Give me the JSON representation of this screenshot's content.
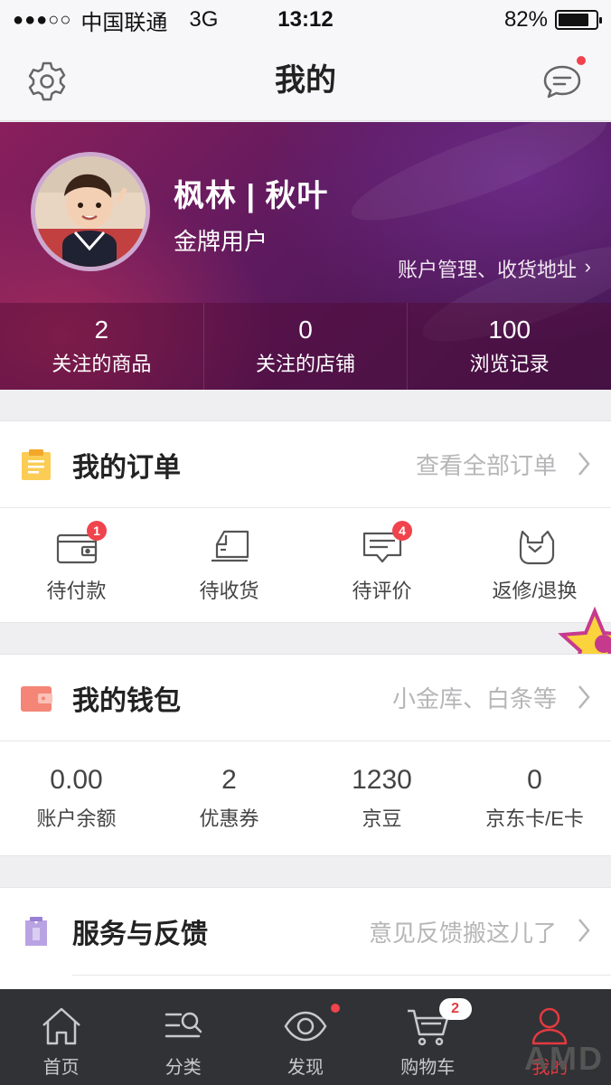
{
  "status_bar": {
    "signal": "●●●○○",
    "carrier": "中国联通",
    "network": "3G",
    "time": "13:12",
    "battery_text": "82%",
    "battery_level": 0.82
  },
  "nav": {
    "title": "我的",
    "settings_icon": "gear-icon",
    "message_icon": "message-icon"
  },
  "profile": {
    "name": "枫林 | 秋叶",
    "level": "金牌用户",
    "account_link": "账户管理、收货地址",
    "chevron": "›",
    "stats": [
      {
        "value": "2",
        "label": "关注的商品"
      },
      {
        "value": "0",
        "label": "关注的店铺"
      },
      {
        "value": "100",
        "label": "浏览记录"
      }
    ]
  },
  "orders": {
    "title": "我的订单",
    "link": "查看全部订单",
    "items": [
      {
        "label": "待付款",
        "badge": "1",
        "icon": "wallet-icon"
      },
      {
        "label": "待收货",
        "badge": "",
        "icon": "truck-icon"
      },
      {
        "label": "待评价",
        "badge": "4",
        "icon": "comment-icon"
      },
      {
        "label": "返修/退换",
        "badge": "",
        "icon": "return-icon"
      }
    ]
  },
  "wallet": {
    "title": "我的钱包",
    "link": "小金库、白条等",
    "items": [
      {
        "value": "0.00",
        "label": "账户余额"
      },
      {
        "value": "2",
        "label": "优惠券"
      },
      {
        "value": "1230",
        "label": "京豆"
      },
      {
        "value": "0",
        "label": "京东卡/E卡"
      }
    ]
  },
  "service": {
    "title": "服务与反馈",
    "link": "意见反馈搬这儿了"
  },
  "tabs": [
    {
      "label": "首页",
      "icon": "home-icon"
    },
    {
      "label": "分类",
      "icon": "category-icon"
    },
    {
      "label": "发现",
      "icon": "eye-icon"
    },
    {
      "label": "购物车",
      "icon": "cart-icon",
      "badge": "2"
    },
    {
      "label": "我的",
      "icon": "user-icon",
      "active": true
    }
  ],
  "watermark": "AMD",
  "colors": {
    "accent": "#e23a3f",
    "badge": "#f0434c",
    "tab_bar": "#303236",
    "profile_bg": "#6b1f5e"
  }
}
